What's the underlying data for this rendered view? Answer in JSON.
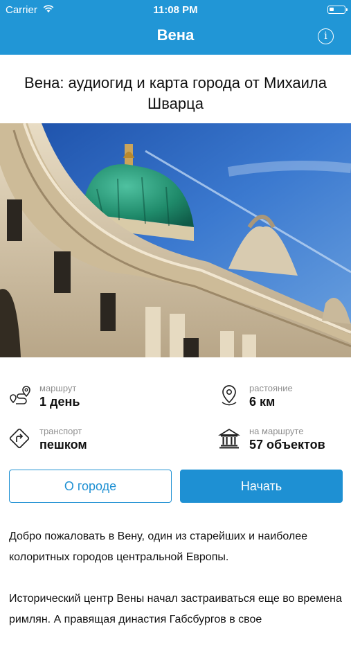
{
  "status_bar": {
    "carrier": "Carrier",
    "time": "11:08 PM"
  },
  "nav": {
    "title": "Вена",
    "info_icon": "info-icon"
  },
  "page": {
    "title": "Вена: аудиогид и карта города от Михаила Шварца"
  },
  "stats": {
    "route": {
      "label": "маршрут",
      "value": "1 день",
      "icon": "route-icon"
    },
    "distance": {
      "label": "растояние",
      "value": "6 км",
      "icon": "location-pin-icon"
    },
    "transport": {
      "label": "транспорт",
      "value": "пешком",
      "icon": "directions-sign-icon"
    },
    "objects": {
      "label": "на маршруте",
      "value": "57 объектов",
      "icon": "museum-icon"
    }
  },
  "buttons": {
    "about": "О городе",
    "start": "Начать"
  },
  "description": {
    "p1": "Добро пожаловать в Вену, один из старейших и наиболее колоритных городов центральной Европы.",
    "p2": "Исторический центр Вены начал застраиваться еще во времена римлян. А правящая династия Габсбургов в свое"
  },
  "colors": {
    "accent": "#1e90d3",
    "header": "#2196d6",
    "dome": "#1f8a6a",
    "sky": "#3a7bd0"
  }
}
